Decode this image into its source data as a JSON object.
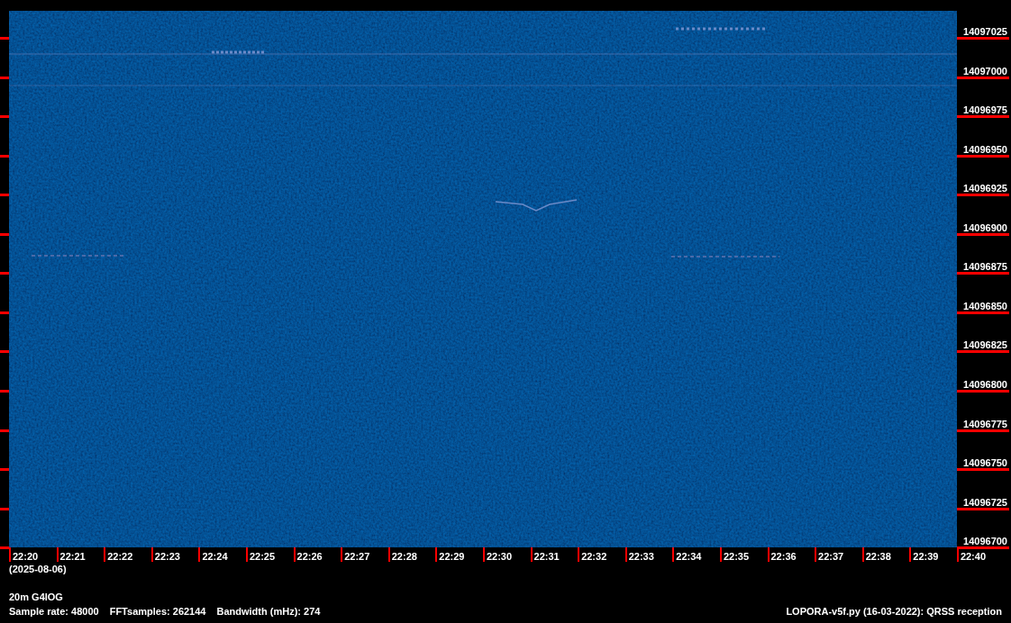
{
  "frequency_labels": [
    "14097025",
    "14097000",
    "14096975",
    "14096950",
    "14096925",
    "14096900",
    "14096875",
    "14096850",
    "14096825",
    "14096800",
    "14096775",
    "14096750",
    "14096725",
    "14096700"
  ],
  "time_labels": [
    "22:20",
    "22:21",
    "22:22",
    "22:23",
    "22:24",
    "22:25",
    "22:26",
    "22:27",
    "22:28",
    "22:29",
    "22:30",
    "22:31",
    "22:32",
    "22:33",
    "22:34",
    "22:35",
    "22:36",
    "22:37",
    "22:38",
    "22:39",
    "22:40"
  ],
  "date": "(2025-08-06)",
  "station": "20m G4IOG",
  "parameters": [
    "Sample rate: 48000",
    "FFTsamples: 262144",
    "Bandwidth (mHz): 274"
  ],
  "software": "LOPORA-v5f.py (16-03-2022): QRSS reception"
}
